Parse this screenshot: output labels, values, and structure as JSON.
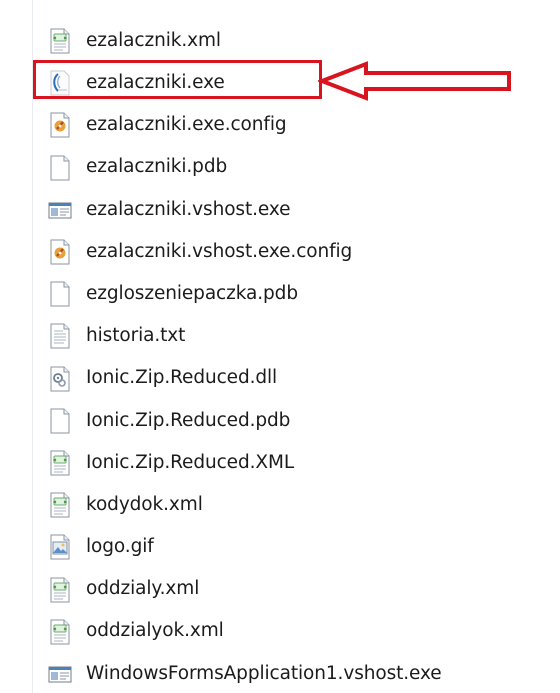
{
  "files": [
    {
      "name": "ezalacznik.xml",
      "icon": "xml-document-icon"
    },
    {
      "name": "ezalaczniki.exe",
      "icon": "application-exe-icon"
    },
    {
      "name": "ezalaczniki.exe.config",
      "icon": "config-file-icon"
    },
    {
      "name": "ezalaczniki.pdb",
      "icon": "blank-file-icon"
    },
    {
      "name": "ezalaczniki.vshost.exe",
      "icon": "window-exe-icon"
    },
    {
      "name": "ezalaczniki.vshost.exe.config",
      "icon": "config-file-icon"
    },
    {
      "name": "ezgloszeniepaczka.pdb",
      "icon": "blank-file-icon"
    },
    {
      "name": "historia.txt",
      "icon": "text-file-icon"
    },
    {
      "name": "Ionic.Zip.Reduced.dll",
      "icon": "dll-file-icon"
    },
    {
      "name": "Ionic.Zip.Reduced.pdb",
      "icon": "blank-file-icon"
    },
    {
      "name": "Ionic.Zip.Reduced.XML",
      "icon": "xml-document-icon"
    },
    {
      "name": "kodydok.xml",
      "icon": "xml-document-icon"
    },
    {
      "name": "logo.gif",
      "icon": "image-file-icon"
    },
    {
      "name": "oddzialy.xml",
      "icon": "xml-document-icon"
    },
    {
      "name": "oddzialyok.xml",
      "icon": "xml-document-icon"
    },
    {
      "name": "WindowsFormsApplication1.vshost.exe",
      "icon": "window-exe-icon"
    }
  ],
  "highlight": {
    "file": "ezalaczniki.exe",
    "color": "#d8141e"
  }
}
